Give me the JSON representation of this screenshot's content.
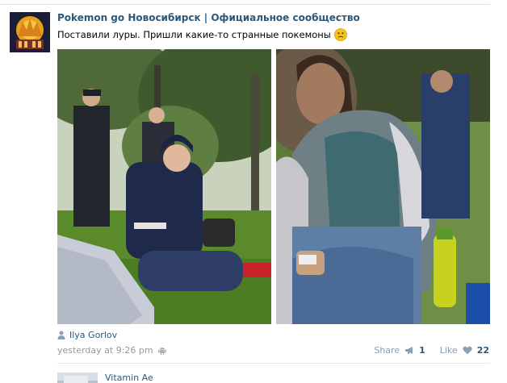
{
  "post": {
    "author": "Pokemon go Новосибирск | Официальное сообщество",
    "text": "Поставили луры. Пришли какие-то странные покемоны",
    "emoji_icon": "confused-face-emoji",
    "photos": [
      "photo-park-police",
      "photo-blurred-person"
    ],
    "signer": "Ilya Gorlov",
    "timestamp": "yesterday at 9:26 pm",
    "platform_icon": "android-icon"
  },
  "actions": {
    "share_label": "Share",
    "share_count": "1",
    "like_label": "Like",
    "like_count": "22"
  },
  "reply": {
    "name": "Vitamin Ae"
  },
  "colors": {
    "link": "#2b587a",
    "muted": "#999999",
    "action": "#8a9bb0",
    "divider": "#e7e8ec"
  }
}
